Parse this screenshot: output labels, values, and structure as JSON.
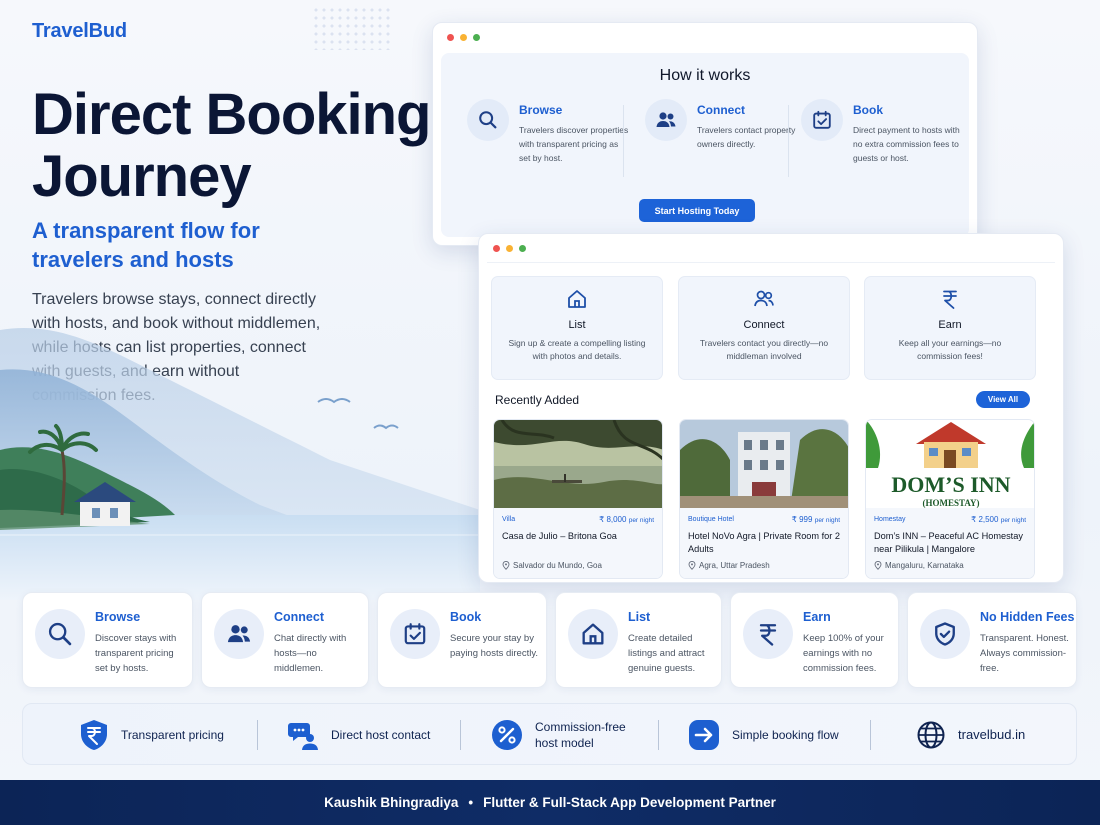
{
  "brand": "TravelBud",
  "hero": {
    "title": "Direct Booking Journey",
    "subtitle": "A transparent flow for travelers and hosts",
    "description": "Travelers browse stays, connect directly with hosts, and book without middlemen, while hosts can list properties, connect with guests, and earn without commission fees."
  },
  "how_it_works": {
    "title": "How it works",
    "steps": [
      {
        "name": "Browse",
        "icon": "search-icon",
        "text": "Travelers discover properties with transparent pricing as set by host."
      },
      {
        "name": "Connect",
        "icon": "users-icon",
        "text": "Travelers contact property owners directly."
      },
      {
        "name": "Book",
        "icon": "calendar-check-icon",
        "text": "Direct payment to hosts with no extra commission fees to guests or host."
      }
    ],
    "cta": "Start Hosting Today"
  },
  "host_features": [
    {
      "name": "List",
      "icon": "home-icon",
      "text": "Sign up & create a compelling listing with photos and details."
    },
    {
      "name": "Connect",
      "icon": "users-icon",
      "text": "Travelers contact you directly—no middleman involved"
    },
    {
      "name": "Earn",
      "icon": "rupee-icon",
      "text": "Keep all your earnings—no commission fees!"
    }
  ],
  "recent": {
    "title": "Recently Added",
    "view_all": "View All",
    "listings": [
      {
        "category": "Villa",
        "price": "₹ 8,000",
        "per": "per night",
        "name": "Casa de Julio – Britona Goa",
        "location": "Salvador du Mundo, Goa"
      },
      {
        "category": "Boutique Hotel",
        "price": "₹ 999",
        "per": "per night",
        "name": "Hotel NoVo Agra | Private Room for 2 Adults",
        "location": "Agra, Uttar Pradesh"
      },
      {
        "category": "Homestay",
        "price": "₹ 2,500",
        "per": "per night",
        "name": "Dom’s INN – Peaceful AC Homestay near Pilikula | Mangalore",
        "location": "Mangaluru, Karnataka",
        "image_text_1": "DOM’S INN",
        "image_text_2": "(HOMESTAY)"
      }
    ]
  },
  "benefits": [
    {
      "name": "Browse",
      "icon": "search-icon",
      "text": "Discover stays with transparent pricing set by hosts."
    },
    {
      "name": "Connect",
      "icon": "users-icon",
      "text": "Chat directly with hosts—no middlemen."
    },
    {
      "name": "Book",
      "icon": "calendar-check-icon",
      "text": "Secure your stay by paying hosts directly."
    },
    {
      "name": "List",
      "icon": "home-icon",
      "text": "Create detailed listings and attract genuine guests."
    },
    {
      "name": "Earn",
      "icon": "rupee-icon",
      "text": "Keep 100% of your earnings with no commission fees."
    },
    {
      "name": "No Hidden Fees",
      "icon": "shield-check-icon",
      "text": "Transparent. Honest. Always commission-free."
    }
  ],
  "strip": [
    {
      "label": "Transparent pricing",
      "icon": "rupee-shield-icon"
    },
    {
      "label": "Direct host contact",
      "icon": "chat-person-icon"
    },
    {
      "label": "Commission-free host model",
      "icon": "percent-icon"
    },
    {
      "label": "Simple booking flow",
      "icon": "arrow-right-icon"
    },
    {
      "label": "travelbud.in",
      "icon": "globe-icon"
    }
  ],
  "footer": {
    "name": "Kaushik Bhingradiya",
    "separator": "•",
    "role": "Flutter & Full-Stack App Development Partner"
  },
  "colors": {
    "accent": "#1e5fd0",
    "button": "#1d63d8",
    "dark": "#0b1635",
    "footer": "#0c2456"
  }
}
